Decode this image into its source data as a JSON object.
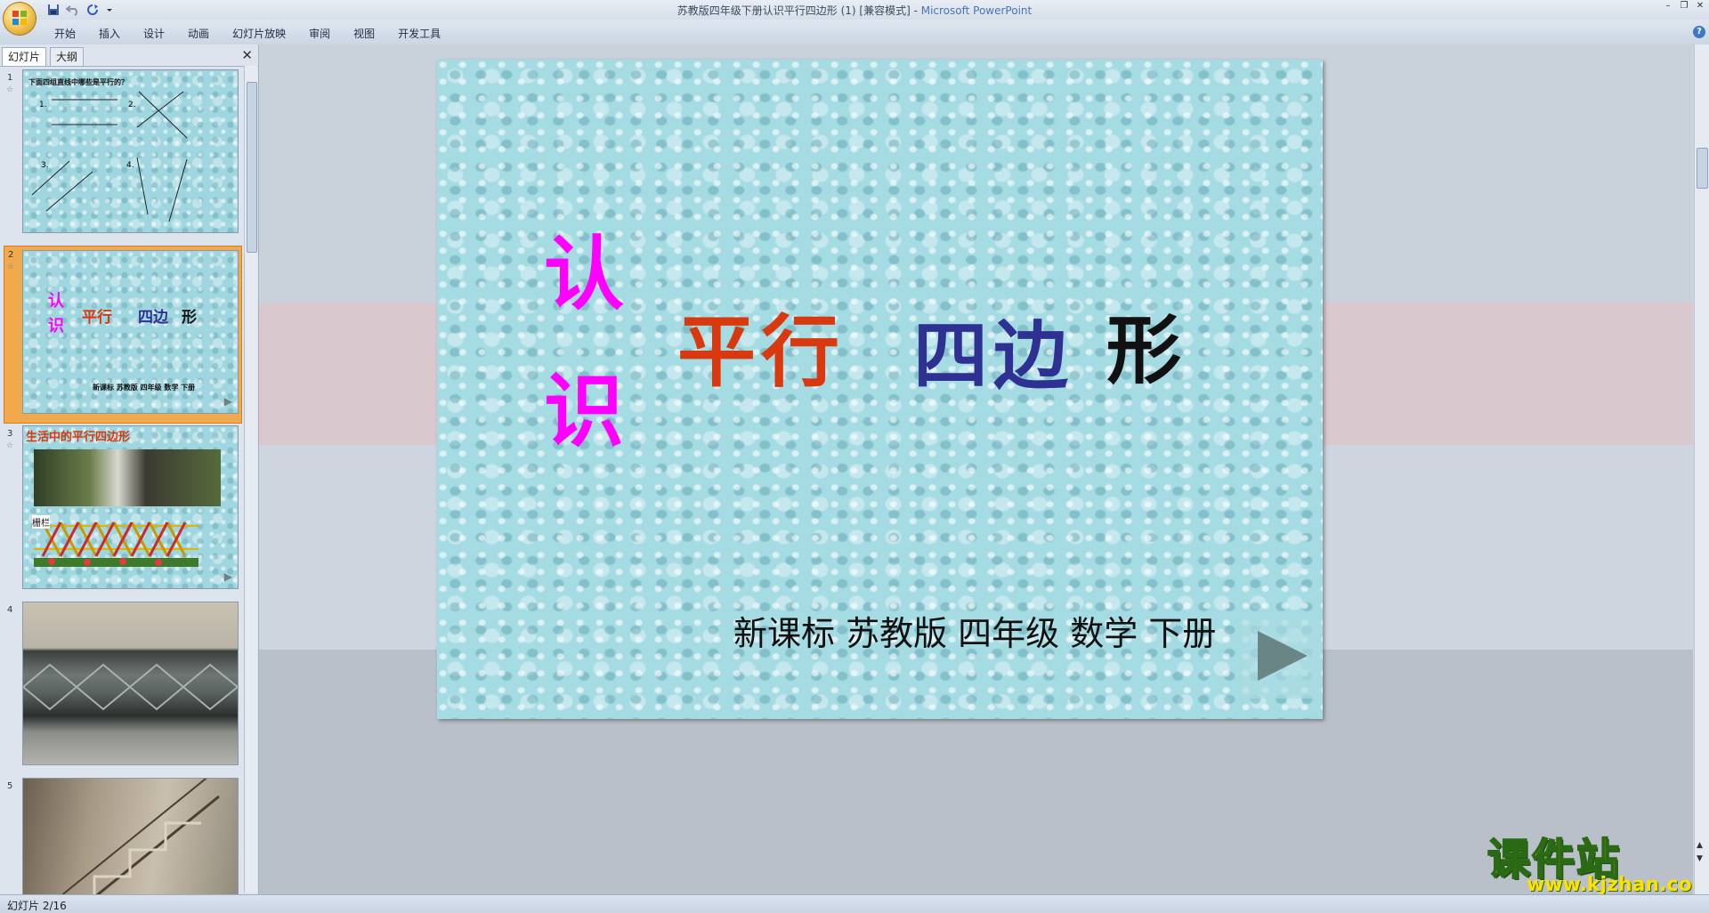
{
  "window": {
    "title_doc": "苏教版四年级下册认识平行四边形 (1) [兼容模式] - ",
    "title_app": "Microsoft PowerPoint"
  },
  "ribbon": {
    "tabs": [
      "开始",
      "插入",
      "设计",
      "动画",
      "幻灯片放映",
      "审阅",
      "视图",
      "开发工具"
    ]
  },
  "left_pane": {
    "tab_slides": "幻灯片",
    "tab_outline": "大纲",
    "thumbnails": [
      {
        "num": "1",
        "title": "下面四组直线中哪些是平行的？",
        "labels": [
          "1.",
          "2.",
          "3.",
          "4."
        ]
      },
      {
        "num": "2",
        "line1": "认",
        "line2": "识",
        "main": [
          "平行",
          "四边",
          "形"
        ],
        "footer": "新课标 苏教版 四年级 数学 下册"
      },
      {
        "num": "3",
        "title": "生活中的平行四边形",
        "label": "栅栏"
      },
      {
        "num": "4"
      },
      {
        "num": "5"
      }
    ]
  },
  "slide": {
    "ren": "认",
    "shi": "识",
    "pingxing": "平行",
    "sibian": "四边",
    "xing": "形",
    "footer": "新课标 苏教版 四年级 数学 下册"
  },
  "colors": {
    "magenta": "#ff00ff",
    "red_orange": "#d9390f",
    "navy": "#2e3192",
    "black": "#111111"
  },
  "watermark": {
    "text": "课件站",
    "url": "www.kjzhan.com"
  },
  "status": {
    "slide_counter": "幻灯片 2/16"
  }
}
